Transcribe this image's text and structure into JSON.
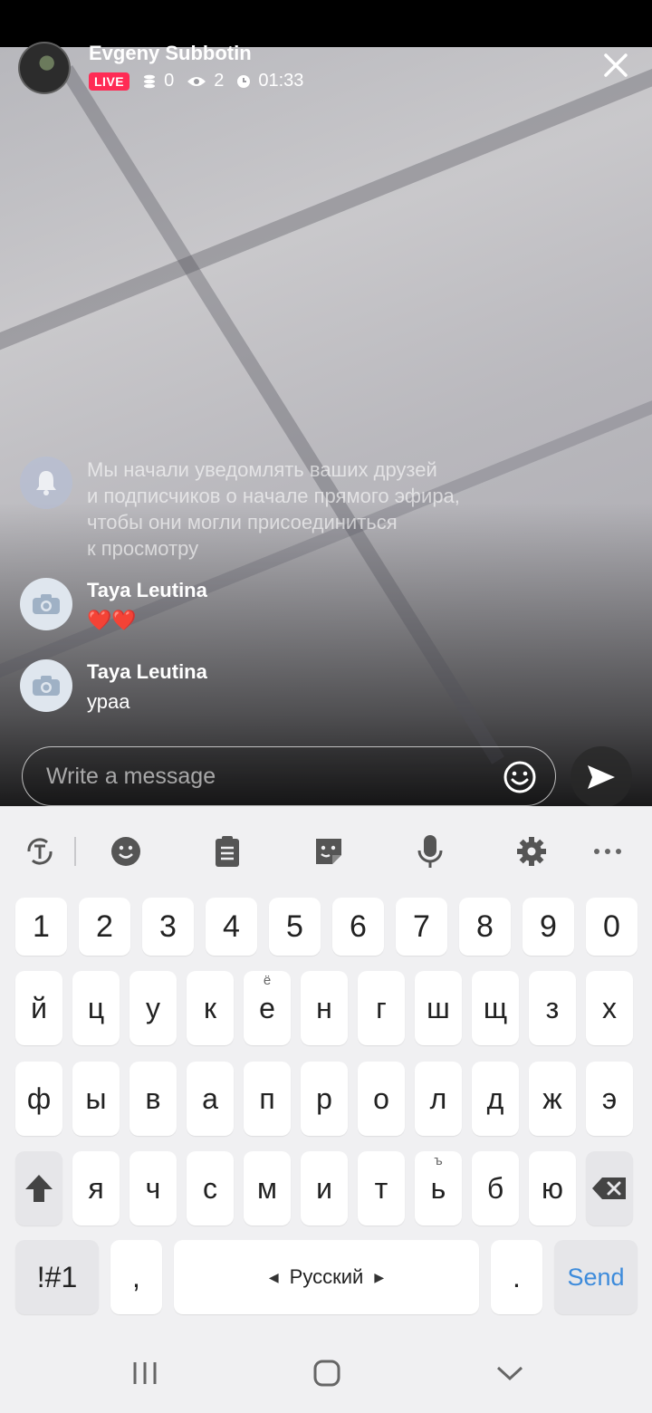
{
  "header": {
    "streamer_name": "Evgeny Subbotin",
    "live_label": "LIVE",
    "coins": "0",
    "viewers": "2",
    "duration": "01:33"
  },
  "notice": {
    "lines": [
      "Мы начали уведомлять ваших друзей",
      "и подписчиков о начале прямого эфира,",
      "чтобы они могли присоединиться",
      "к просмотру"
    ]
  },
  "comments": [
    {
      "name": "Taya Leutina",
      "text": "❤️❤️"
    },
    {
      "name": "Taya Leutina",
      "text": "ураа"
    }
  ],
  "input": {
    "placeholder": "Write a message"
  },
  "keyboard": {
    "numbers": [
      "1",
      "2",
      "3",
      "4",
      "5",
      "6",
      "7",
      "8",
      "9",
      "0"
    ],
    "row1": [
      "й",
      "ц",
      "у",
      "к",
      "е",
      "н",
      "г",
      "ш",
      "щ",
      "з",
      "х"
    ],
    "row1_sub_e": "ё",
    "row2": [
      "ф",
      "ы",
      "в",
      "а",
      "п",
      "р",
      "о",
      "л",
      "д",
      "ж",
      "э"
    ],
    "row3": [
      "я",
      "ч",
      "с",
      "м",
      "и",
      "т",
      "ь",
      "б",
      "ю"
    ],
    "row3_sub_soft": "ъ",
    "symbols_label": "!#1",
    "comma": ",",
    "space_label": "Русский",
    "period": ".",
    "send_label": "Send"
  },
  "colors": {
    "live_badge": "#ff2b55",
    "send_key_text": "#3d8bdb",
    "keyboard_bg": "#f0f0f2"
  },
  "icons": {
    "toolbar": [
      "translate-icon",
      "emoji-icon",
      "clipboard-icon",
      "sticker-icon",
      "mic-icon",
      "settings-icon",
      "more-icon"
    ],
    "nav": [
      "recents-icon",
      "home-icon",
      "back-icon"
    ]
  }
}
